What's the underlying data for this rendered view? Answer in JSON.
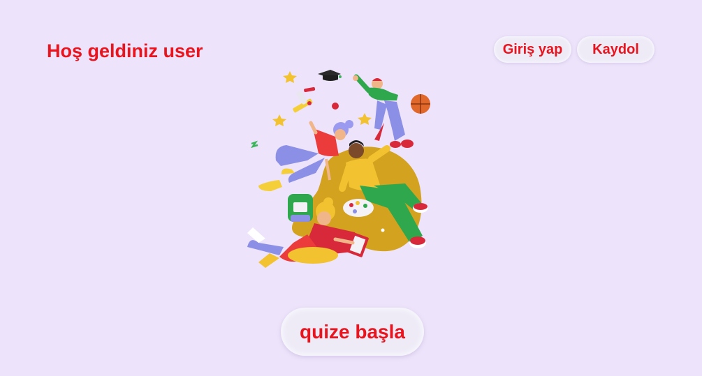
{
  "header": {
    "welcome_text": "Hoş geldiniz user",
    "login_label": "Giriş yap",
    "register_label": "Kaydol"
  },
  "hero": {
    "illustration": "students-floating-illustration"
  },
  "main": {
    "start_label": "quize başla"
  },
  "colors": {
    "background": "#ede3fa",
    "accent": "#e8141e",
    "button_bg": "#eeebf7"
  }
}
